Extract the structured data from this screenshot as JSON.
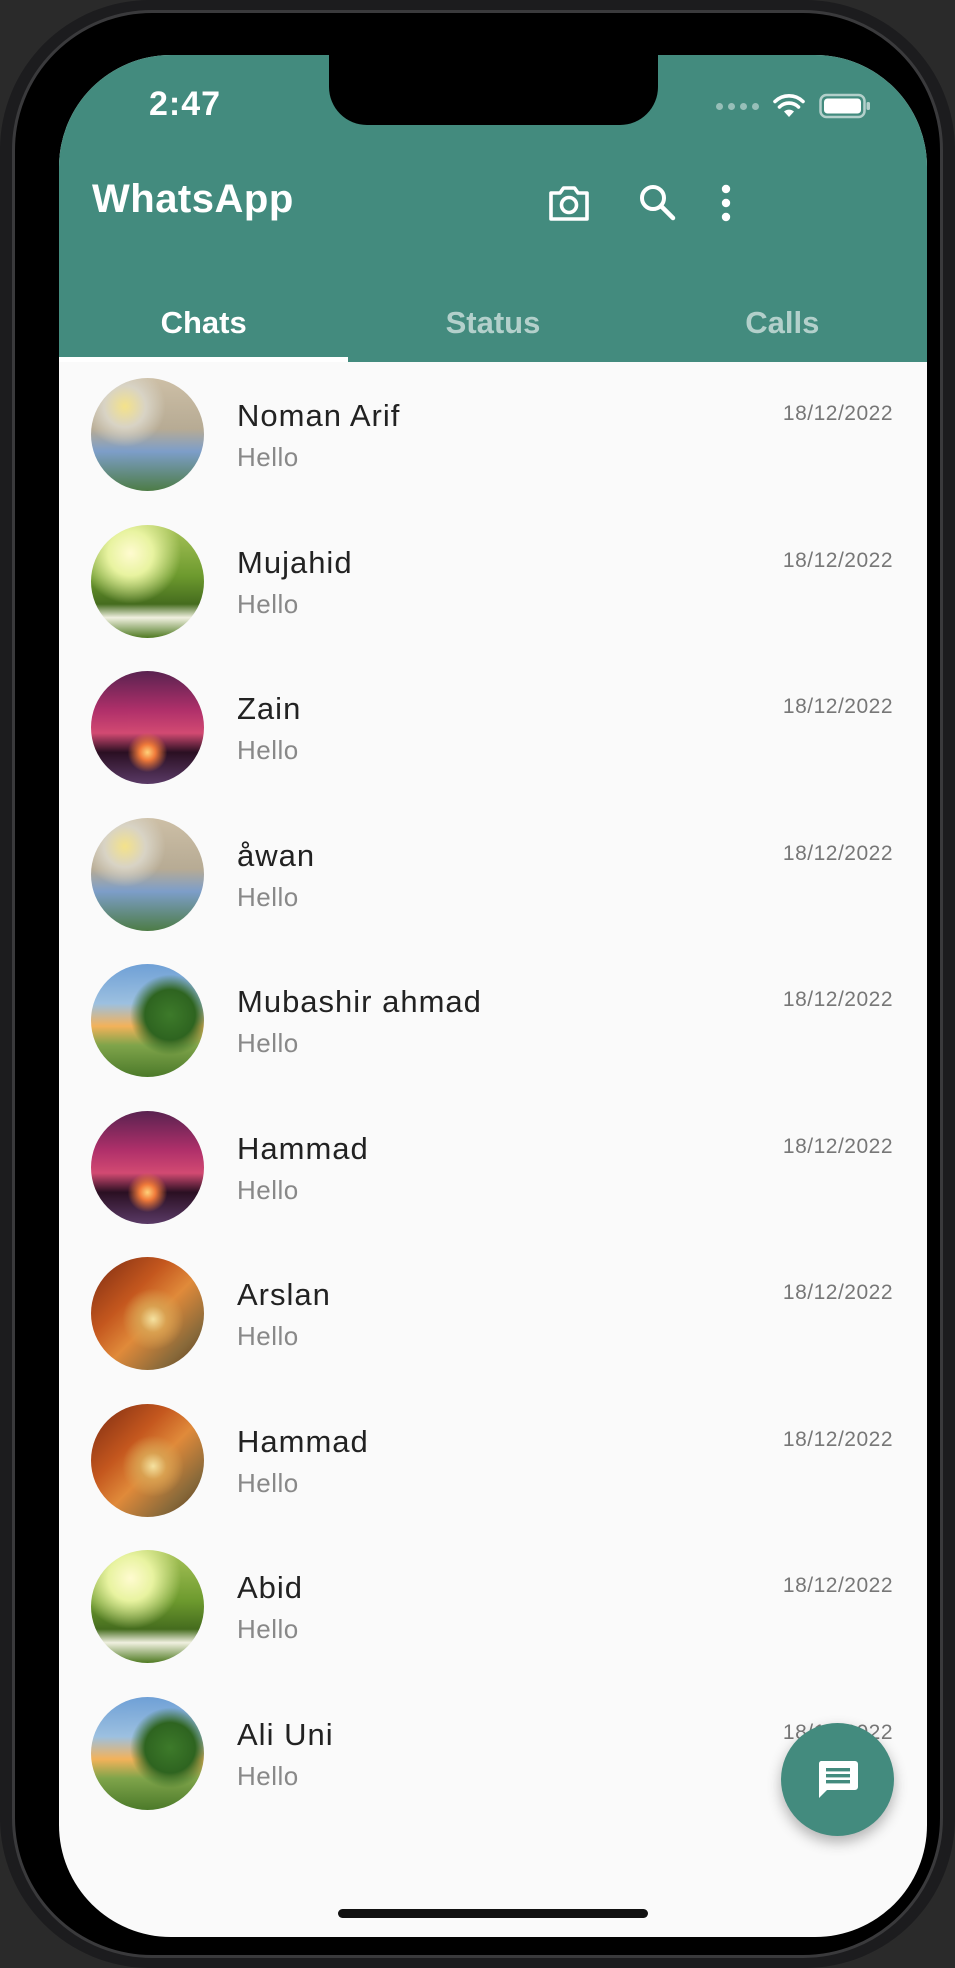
{
  "status_bar": {
    "time": "2:47"
  },
  "app_bar": {
    "title": "WhatsApp",
    "actions": [
      "camera-icon",
      "search-icon",
      "more-vert-icon"
    ]
  },
  "tabs": [
    {
      "label": "Chats",
      "active": true
    },
    {
      "label": "Status",
      "active": false
    },
    {
      "label": "Calls",
      "active": false
    }
  ],
  "chats": [
    {
      "name": "Noman Arif",
      "message": "Hello",
      "date": "18/12/2022",
      "avatar": "squirrel"
    },
    {
      "name": "Mujahid",
      "message": "Hello",
      "date": "18/12/2022",
      "avatar": "meadow"
    },
    {
      "name": "Zain",
      "message": "Hello",
      "date": "18/12/2022",
      "avatar": "sunset"
    },
    {
      "name": "åwan",
      "message": "Hello",
      "date": "18/12/2022",
      "avatar": "squirrel"
    },
    {
      "name": "Mubashir ahmad",
      "message": "Hello",
      "date": "18/12/2022",
      "avatar": "tree"
    },
    {
      "name": "Hammad",
      "message": "Hello",
      "date": "18/12/2022",
      "avatar": "sunset"
    },
    {
      "name": "Arslan",
      "message": "Hello",
      "date": "18/12/2022",
      "avatar": "autumn"
    },
    {
      "name": "Hammad",
      "message": "Hello",
      "date": "18/12/2022",
      "avatar": "autumn"
    },
    {
      "name": "Abid",
      "message": "Hello",
      "date": "18/12/2022",
      "avatar": "meadow"
    },
    {
      "name": "Ali Uni",
      "message": "Hello",
      "date": "18/12/2022",
      "avatar": "tree"
    }
  ],
  "fab": {
    "icon": "message-icon"
  },
  "colors": {
    "primary": "#438b7e",
    "background": "#fafafa"
  }
}
